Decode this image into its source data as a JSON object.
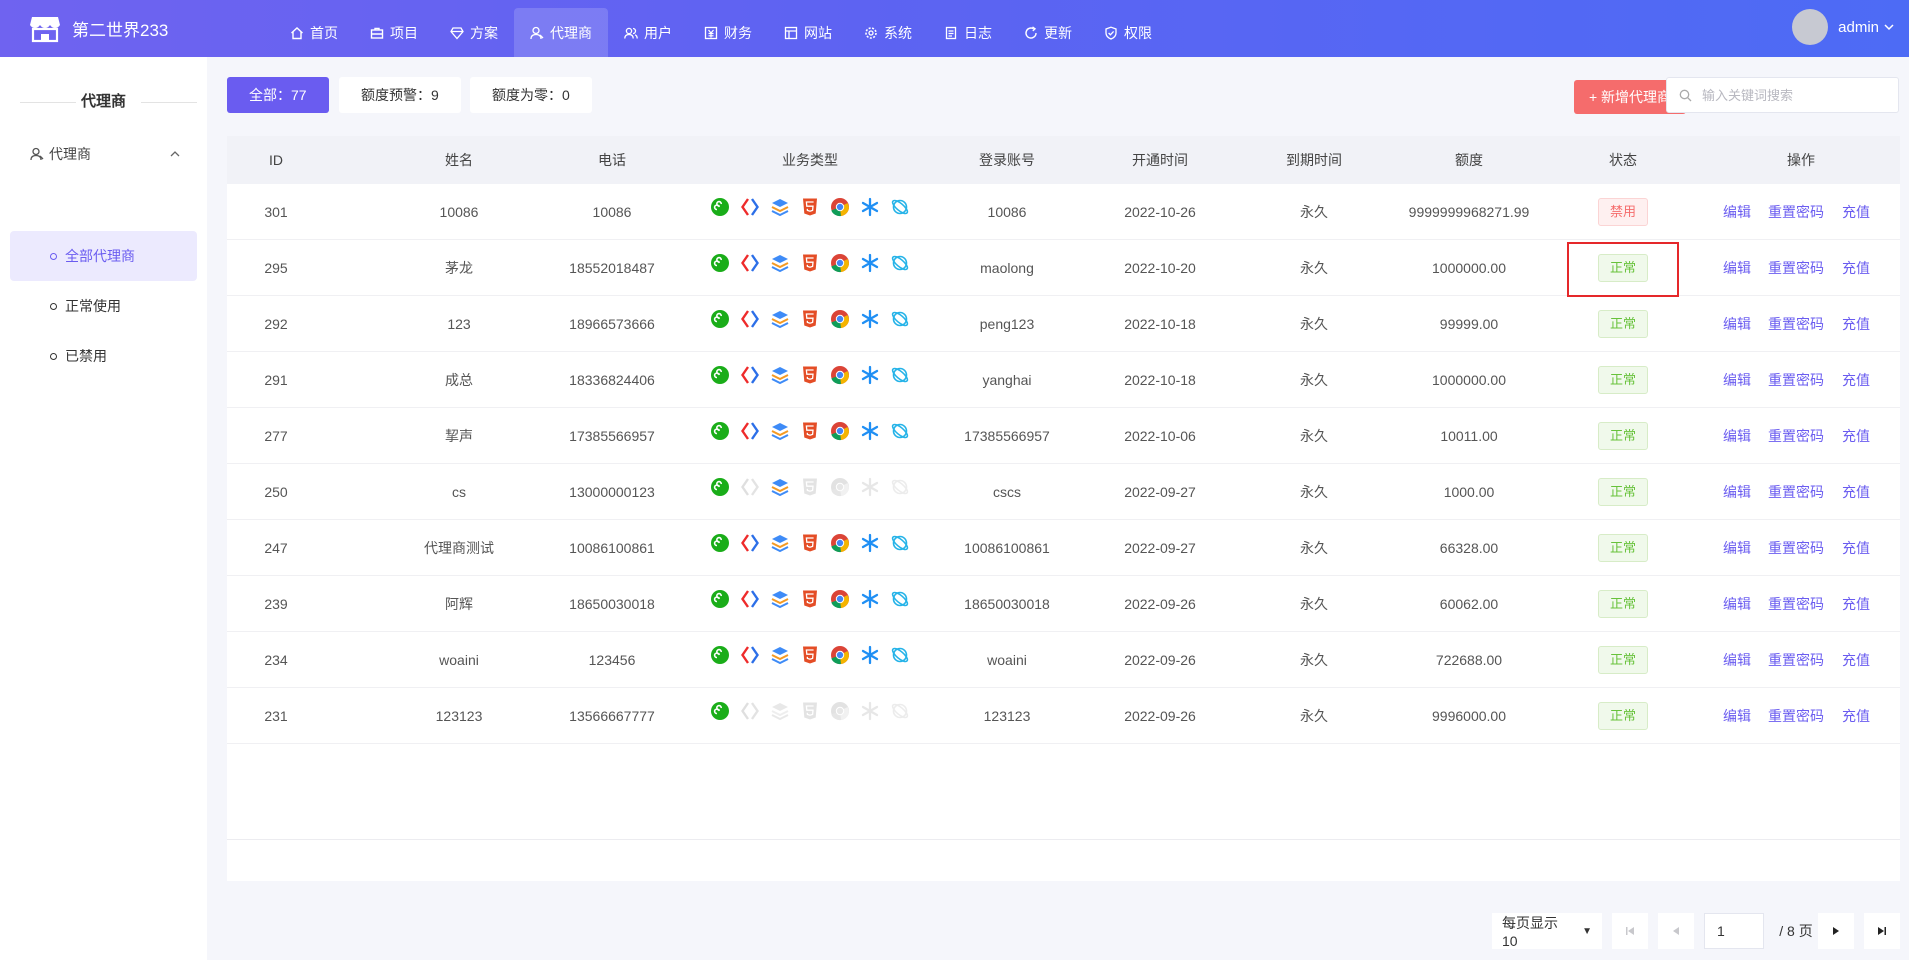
{
  "brand": {
    "name": "第二世界233"
  },
  "nav": [
    {
      "label": "首页",
      "icon": "home-icon"
    },
    {
      "label": "项目",
      "icon": "briefcase-icon"
    },
    {
      "label": "方案",
      "icon": "diamond-icon"
    },
    {
      "label": "代理商",
      "icon": "user-icon",
      "active": true
    },
    {
      "label": "用户",
      "icon": "users-icon"
    },
    {
      "label": "财务",
      "icon": "finance-icon"
    },
    {
      "label": "网站",
      "icon": "browser-icon"
    },
    {
      "label": "系统",
      "icon": "gear-icon"
    },
    {
      "label": "日志",
      "icon": "file-icon"
    },
    {
      "label": "更新",
      "icon": "refresh-icon"
    },
    {
      "label": "权限",
      "icon": "shield-icon"
    }
  ],
  "user": {
    "name": "admin"
  },
  "sidebar": {
    "title": "代理商",
    "group": "代理商",
    "items": [
      {
        "label": "全部代理商",
        "active": true
      },
      {
        "label": "正常使用"
      },
      {
        "label": "已禁用"
      }
    ]
  },
  "filters": [
    {
      "label": "全部：77",
      "active": true
    },
    {
      "label": "额度预警：9"
    },
    {
      "label": "额度为零：0"
    }
  ],
  "toolbar": {
    "add_label": "+ 新增代理商",
    "search_placeholder": "输入关键词搜索"
  },
  "table": {
    "headers": [
      "ID",
      "姓名",
      "电话",
      "业务类型",
      "登录账号",
      "开通时间",
      "到期时间",
      "额度",
      "状态",
      "操作"
    ],
    "biz_icons": [
      "miniprogram-icon",
      "code-icon",
      "layers-icon",
      "html5-icon",
      "chrome-icon",
      "asterisk-icon",
      "planet-icon"
    ],
    "actions": [
      "编辑",
      "重置密码",
      "充值"
    ],
    "rows": [
      {
        "id": "301",
        "name": "10086",
        "phone": "10086",
        "account": "10086",
        "open": "2022-10-26",
        "expire": "永久",
        "quota": "9999999968271.99",
        "status": "禁用",
        "status_type": "ban",
        "biz": [
          1,
          1,
          1,
          1,
          1,
          1,
          1
        ]
      },
      {
        "id": "295",
        "name": "茅龙",
        "phone": "18552018487",
        "account": "maolong",
        "open": "2022-10-20",
        "expire": "永久",
        "quota": "1000000.00",
        "status": "正常",
        "status_type": "ok",
        "biz": [
          1,
          1,
          1,
          1,
          1,
          1,
          1
        ]
      },
      {
        "id": "292",
        "name": "123",
        "phone": "18966573666",
        "account": "peng123",
        "open": "2022-10-18",
        "expire": "永久",
        "quota": "99999.00",
        "status": "正常",
        "status_type": "ok",
        "biz": [
          1,
          1,
          1,
          1,
          1,
          1,
          1
        ]
      },
      {
        "id": "291",
        "name": "成总",
        "phone": "18336824406",
        "account": "yanghai",
        "open": "2022-10-18",
        "expire": "永久",
        "quota": "1000000.00",
        "status": "正常",
        "status_type": "ok",
        "biz": [
          1,
          1,
          1,
          1,
          1,
          1,
          1
        ]
      },
      {
        "id": "277",
        "name": "挈声",
        "phone": "17385566957",
        "account": "17385566957",
        "open": "2022-10-06",
        "expire": "永久",
        "quota": "10011.00",
        "status": "正常",
        "status_type": "ok",
        "biz": [
          1,
          1,
          1,
          1,
          1,
          1,
          1
        ]
      },
      {
        "id": "250",
        "name": "cs",
        "phone": "13000000123",
        "account": "cscs",
        "open": "2022-09-27",
        "expire": "永久",
        "quota": "1000.00",
        "status": "正常",
        "status_type": "ok",
        "biz": [
          1,
          0,
          1,
          0,
          0,
          0,
          0
        ]
      },
      {
        "id": "247",
        "name": "代理商测试",
        "phone": "10086100861",
        "account": "10086100861",
        "open": "2022-09-27",
        "expire": "永久",
        "quota": "66328.00",
        "status": "正常",
        "status_type": "ok",
        "biz": [
          1,
          1,
          1,
          1,
          1,
          1,
          1
        ]
      },
      {
        "id": "239",
        "name": "阿辉",
        "phone": "18650030018",
        "account": "18650030018",
        "open": "2022-09-26",
        "expire": "永久",
        "quota": "60062.00",
        "status": "正常",
        "status_type": "ok",
        "biz": [
          1,
          1,
          1,
          1,
          1,
          1,
          1
        ]
      },
      {
        "id": "234",
        "name": "woaini",
        "phone": "123456",
        "account": "woaini",
        "open": "2022-09-26",
        "expire": "永久",
        "quota": "722688.00",
        "status": "正常",
        "status_type": "ok",
        "biz": [
          1,
          1,
          1,
          1,
          1,
          1,
          1
        ]
      },
      {
        "id": "231",
        "name": "123123",
        "phone": "13566667777",
        "account": "123123",
        "open": "2022-09-26",
        "expire": "永久",
        "quota": "9996000.00",
        "status": "正常",
        "status_type": "ok",
        "biz": [
          1,
          0,
          0,
          0,
          0,
          0,
          0
        ]
      }
    ]
  },
  "pagination": {
    "page_size_label": "每页显示 10",
    "current_page": "1",
    "total_label": "/ 8 页"
  },
  "colors": {
    "accent": "#6a5cf0",
    "danger": "#f56c6c",
    "success": "#67c23a",
    "highlight": "#e5282a"
  }
}
